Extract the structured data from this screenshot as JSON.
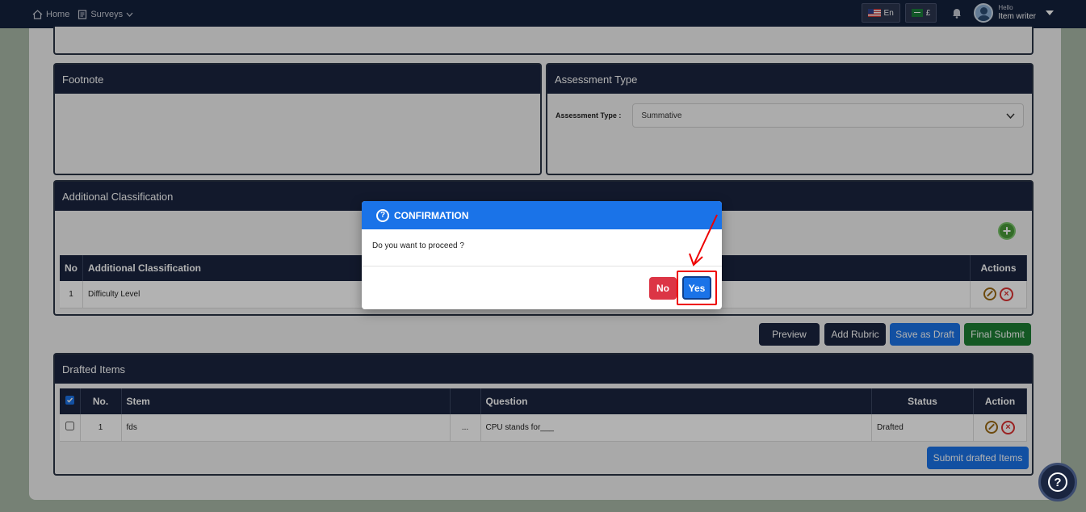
{
  "nav": {
    "home": "Home",
    "surveys": "Surveys",
    "lang": "En",
    "currency": "£",
    "hello": "Hello",
    "user": "Item writer"
  },
  "footnote": {
    "title": "Footnote"
  },
  "assessment": {
    "title": "Assessment Type",
    "label": "Assessment Type :",
    "value": "Summative"
  },
  "classification": {
    "title": "Additional Classification",
    "headers": [
      "No",
      "Additional Classification",
      "Actions"
    ],
    "rows": [
      {
        "no": "1",
        "name": "Difficulty Level"
      }
    ]
  },
  "actions": {
    "preview": "Preview",
    "add_rubric": "Add Rubric",
    "save_draft": "Save as Draft",
    "final_submit": "Final Submit"
  },
  "drafted": {
    "title": "Drafted Items",
    "headers": [
      "No.",
      "Stem",
      "Question",
      "Status",
      "Action"
    ],
    "rows": [
      {
        "no": "1",
        "stem": "fds",
        "more": "...",
        "question": "CPU stands for___",
        "status": "Drafted"
      }
    ],
    "submit": "Submit drafted Items"
  },
  "modal": {
    "title": "CONFIRMATION",
    "message": "Do you want to proceed ?",
    "no": "No",
    "yes": "Yes"
  },
  "colors": {
    "navy": "#1a2540",
    "primary": "#1a73e8",
    "danger": "#dc3545",
    "success": "#1e7e34"
  }
}
